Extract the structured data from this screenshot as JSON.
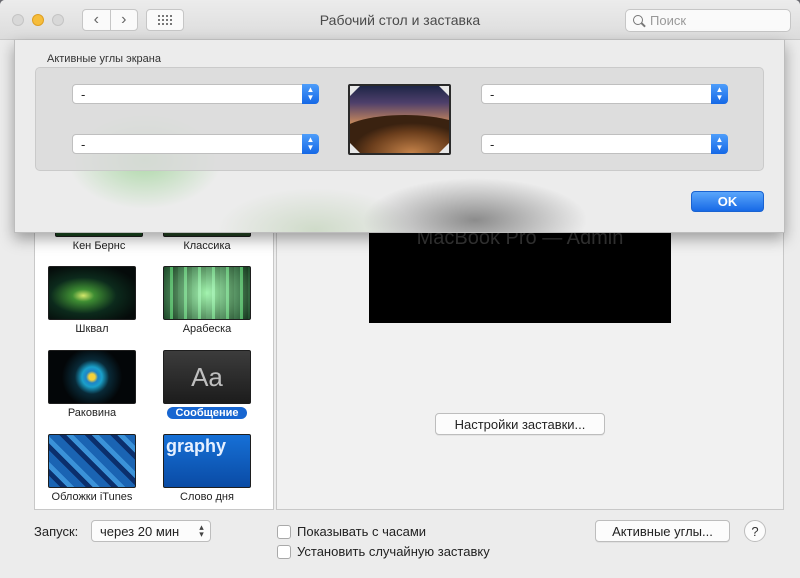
{
  "window": {
    "title": "Рабочий стол и заставка",
    "search_placeholder": "Поиск"
  },
  "sheet": {
    "group_title": "Активные углы экрана",
    "corners": {
      "top_left": "-",
      "bottom_left": "-",
      "top_right": "-",
      "bottom_right": "-"
    },
    "ok_label": "OK"
  },
  "screensavers": [
    {
      "label": "Кен Бернс",
      "icon": "ken-burns-thumbnail"
    },
    {
      "label": "Классика",
      "icon": "classic-thumbnail"
    },
    {
      "label": "Шквал",
      "icon": "flurry-thumbnail"
    },
    {
      "label": "Арабеска",
      "icon": "arabesque-thumbnail"
    },
    {
      "label": "Раковина",
      "icon": "shell-thumbnail"
    },
    {
      "label": "Сообщение",
      "icon": "message-thumbnail",
      "selected": true,
      "thumb_text": "Aa"
    },
    {
      "label": "Обложки iTunes",
      "icon": "itunes-artwork-thumbnail"
    },
    {
      "label": "Слово дня",
      "icon": "word-of-the-day-thumbnail",
      "thumb_text": "graphy"
    }
  ],
  "preview": {
    "text": "MacBook Pro — Admin",
    "settings_button": "Настройки заставки..."
  },
  "bottom": {
    "launch_label": "Запуск:",
    "launch_value": "через 20 мин",
    "show_clock": "Показывать с часами",
    "random_saver": "Установить случайную заставку",
    "hot_corners_button": "Активные углы...",
    "help": "?"
  },
  "colors": {
    "accent": "#1766d1",
    "window_bg": "#ececec"
  }
}
